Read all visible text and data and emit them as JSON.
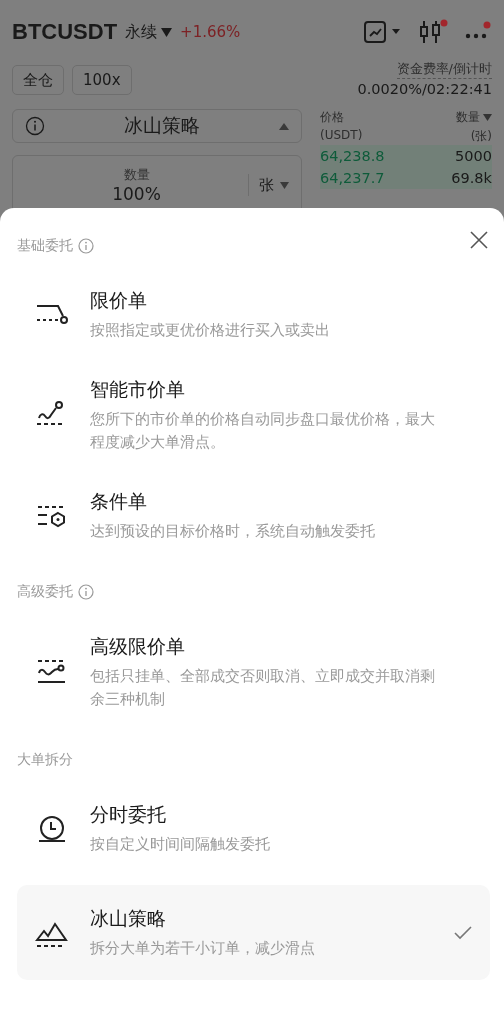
{
  "header": {
    "symbol": "BTCUSDT",
    "contract_type": "永续",
    "change": "+1.66%",
    "chart_badge": false,
    "candles_badge": true,
    "more_badge": true
  },
  "controls": {
    "margin_mode": "全仓",
    "leverage": "100x",
    "funding_label": "资金费率/倒计时",
    "funding_value": "0.0020%/02:22:41"
  },
  "order_type_select": {
    "label": "冰山策略"
  },
  "quantity": {
    "label": "数量",
    "value": "100%",
    "unit": "张"
  },
  "orderbook": {
    "price_header": "价格",
    "price_unit": "(USDT)",
    "qty_header": "数量",
    "qty_unit": "(张)",
    "rows": [
      {
        "price": "64,238.8",
        "qty": "5000"
      },
      {
        "price": "64,237.7",
        "qty": "69.8k"
      }
    ]
  },
  "sheet": {
    "sections": [
      {
        "title": "基础委托",
        "info": true,
        "items": [
          {
            "kind": "limit",
            "title": "限价单",
            "desc": "按照指定或更优价格进行买入或卖出",
            "selected": false
          },
          {
            "kind": "smart-market",
            "title": "智能市价单",
            "desc": "您所下的市价单的价格自动同步盘口最优价格，最大程度减少大单滑点。",
            "selected": false
          },
          {
            "kind": "conditional",
            "title": "条件单",
            "desc": "达到预设的目标价格时，系统自动触发委托",
            "selected": false
          }
        ]
      },
      {
        "title": "高级委托",
        "info": true,
        "items": [
          {
            "kind": "advanced-limit",
            "title": "高级限价单",
            "desc": "包括只挂单、全部成交否则取消、立即成交并取消剩余三种机制",
            "selected": false
          }
        ]
      },
      {
        "title": "大单拆分",
        "info": false,
        "items": [
          {
            "kind": "time-split",
            "title": "分时委托",
            "desc": "按自定义时间间隔触发委托",
            "selected": false
          },
          {
            "kind": "iceberg",
            "title": "冰山策略",
            "desc": "拆分大单为若干小订单，减少滑点",
            "selected": true
          }
        ]
      }
    ]
  }
}
